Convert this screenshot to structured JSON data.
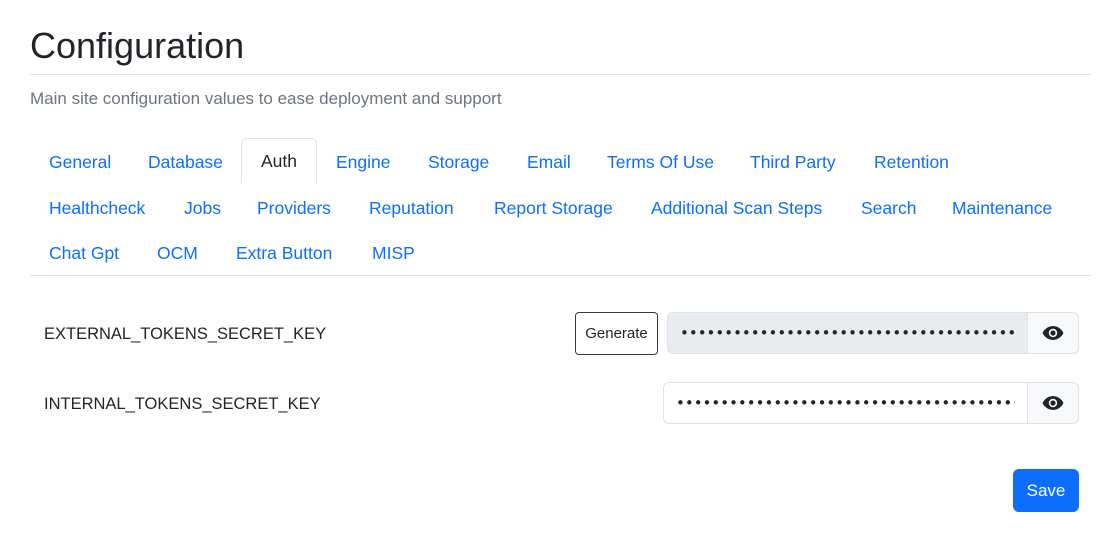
{
  "page": {
    "title": "Configuration",
    "subtitle": "Main site configuration values to ease deployment and support"
  },
  "tabs": [
    {
      "label": "General",
      "active": false
    },
    {
      "label": "Database",
      "active": false
    },
    {
      "label": "Auth",
      "active": true
    },
    {
      "label": "Engine",
      "active": false
    },
    {
      "label": "Storage",
      "active": false
    },
    {
      "label": "Email",
      "active": false
    },
    {
      "label": "Terms Of Use",
      "active": false
    },
    {
      "label": "Third Party",
      "active": false
    },
    {
      "label": "Retention",
      "active": false
    },
    {
      "label": "Healthcheck",
      "active": false
    },
    {
      "label": "Jobs",
      "active": false
    },
    {
      "label": "Providers",
      "active": false
    },
    {
      "label": "Reputation",
      "active": false
    },
    {
      "label": "Report Storage",
      "active": false
    },
    {
      "label": "Additional Scan Steps",
      "active": false
    },
    {
      "label": "Search",
      "active": false
    },
    {
      "label": "Maintenance",
      "active": false
    },
    {
      "label": "Chat Gpt",
      "active": false
    },
    {
      "label": "OCM",
      "active": false
    },
    {
      "label": "Extra Button",
      "active": false
    },
    {
      "label": "MISP",
      "active": false
    }
  ],
  "settings": [
    {
      "key": "EXTERNAL_TOKENS_SECRET_KEY",
      "masked_value": "••••••••••••••••••••••••••••••••••••••••",
      "generate_label": "Generate",
      "disabled": true,
      "toggle_icon": "eye-icon"
    },
    {
      "key": "INTERNAL_TOKENS_SECRET_KEY",
      "masked_value": "••••••••••••••••••••••••••••••••••••••••••",
      "disabled": false,
      "toggle_icon": "eye-icon"
    }
  ],
  "actions": {
    "save_label": "Save"
  },
  "colors": {
    "accent": "#0d6efd",
    "text": "#212529",
    "muted": "#6c757d",
    "border": "#dee2e6",
    "disabled_bg": "#e9ecef"
  }
}
